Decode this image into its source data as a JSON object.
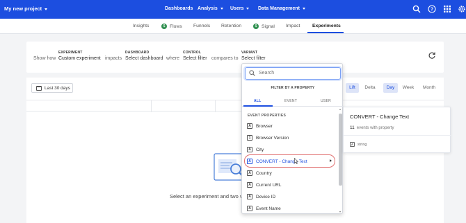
{
  "topbar": {
    "project": "My new project",
    "nav": [
      "Dashboards",
      "Analysis",
      "Users",
      "Data Management"
    ],
    "icons": [
      "search-icon",
      "help-icon",
      "apps-grid-icon",
      "settings-icon"
    ],
    "color": "#1c4ee0"
  },
  "subnav": {
    "tabs": [
      "Insights",
      "Flows",
      "Funnels",
      "Retention",
      "Signal",
      "Impact",
      "Experiments"
    ],
    "badge": "$",
    "active": "Experiments"
  },
  "query": {
    "experiment_label": "EXPERIMENT",
    "experiment_value": "Custom experiment",
    "dashboard_label": "DASHBOARD",
    "dashboard_value": "Select dashboard",
    "control_label": "CONTROL",
    "control_value": "Select filter",
    "variant_label": "VARIANT",
    "variant_value": "Select filter",
    "show_how": "Show how",
    "impacts": "impacts",
    "where": "where",
    "compares_to": "compares to"
  },
  "main": {
    "date_range": "Last 30 days",
    "toggles_left": [
      "Lift",
      "Delta"
    ],
    "toggles_right": [
      "Day",
      "Week",
      "Month"
    ],
    "empty_text": "Select an experiment and two va"
  },
  "dropdown": {
    "search_placeholder": "Search",
    "header": "FILTER BY A PROPERTY",
    "tabs": [
      "ALL",
      "EVENT",
      "USER"
    ],
    "section": "EVENT PROPERTIES",
    "items": [
      {
        "label": "Browser",
        "icon": "A"
      },
      {
        "label": "Browser Version",
        "icon": "1"
      },
      {
        "label": "City",
        "icon": "A"
      },
      {
        "label": "CONVERT - Change Text",
        "icon": "A"
      },
      {
        "label": "Country",
        "icon": "A"
      },
      {
        "label": "Current URL",
        "icon": "A"
      },
      {
        "label": "Device ID",
        "icon": "A"
      },
      {
        "label": "Event Name",
        "icon": "A"
      }
    ]
  },
  "detail": {
    "title": "CONVERT - Change Text",
    "count": "11",
    "count_suffix": "events with property",
    "type_icon": "A",
    "type": "string"
  }
}
